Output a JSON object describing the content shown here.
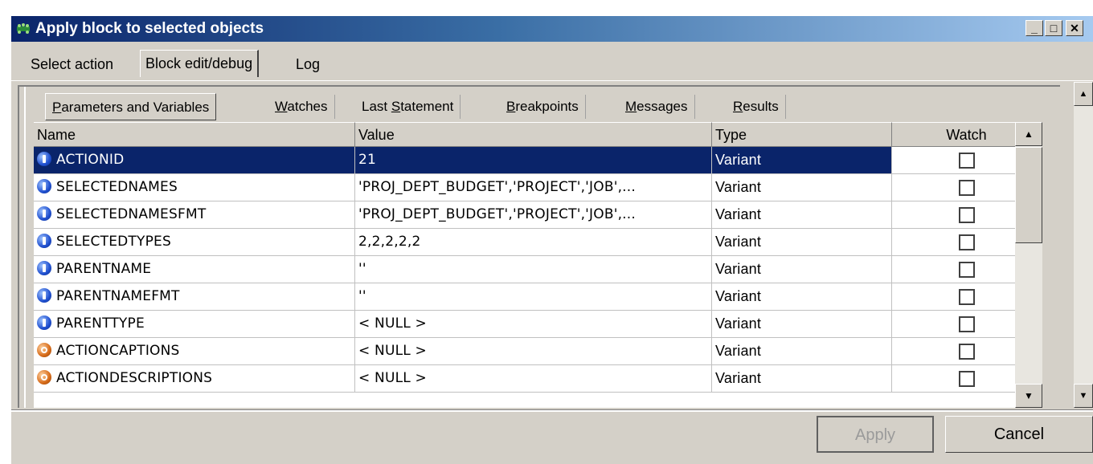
{
  "window": {
    "title": "Apply block to selected objects",
    "controls": {
      "minimize": "_",
      "maximize": "□",
      "close": "✕"
    }
  },
  "outer_tabs": [
    {
      "label": "Select action",
      "active": false
    },
    {
      "label": "Block edit/debug",
      "active": true
    },
    {
      "label": "Log",
      "active": false
    }
  ],
  "inner_tabs": [
    {
      "pre": "",
      "u": "P",
      "post": "arameters and Variables",
      "active": true
    },
    {
      "pre": "",
      "u": "W",
      "post": "atches",
      "active": false
    },
    {
      "pre": "Last ",
      "u": "S",
      "post": "tatement",
      "active": false
    },
    {
      "pre": "",
      "u": "B",
      "post": "reakpoints",
      "active": false
    },
    {
      "pre": "",
      "u": "M",
      "post": "essages",
      "active": false
    },
    {
      "pre": "",
      "u": "R",
      "post": "esults",
      "active": false
    }
  ],
  "grid": {
    "columns": {
      "name": "Name",
      "value": "Value",
      "type": "Type",
      "watch": "Watch"
    },
    "rows": [
      {
        "name": "ACTIONID",
        "value": "21",
        "type": "Variant",
        "kind": "in",
        "selected": true
      },
      {
        "name": "SELECTEDNAMES",
        "value": "'PROJ_DEPT_BUDGET','PROJECT','JOB',...",
        "type": "Variant",
        "kind": "in"
      },
      {
        "name": "SELECTEDNAMESFMT",
        "value": "'PROJ_DEPT_BUDGET','PROJECT','JOB',...",
        "type": "Variant",
        "kind": "in"
      },
      {
        "name": "SELECTEDTYPES",
        "value": "2,2,2,2,2",
        "type": "Variant",
        "kind": "in"
      },
      {
        "name": "PARENTNAME",
        "value": "''",
        "type": "Variant",
        "kind": "in"
      },
      {
        "name": "PARENTNAMEFMT",
        "value": "''",
        "type": "Variant",
        "kind": "in"
      },
      {
        "name": "PARENTTYPE",
        "value": "< NULL >",
        "type": "Variant",
        "kind": "in"
      },
      {
        "name": "ACTIONCAPTIONS",
        "value": "< NULL >",
        "type": "Variant",
        "kind": "out"
      },
      {
        "name": "ACTIONDESCRIPTIONS",
        "value": "< NULL >",
        "type": "Variant",
        "kind": "out"
      }
    ]
  },
  "buttons": {
    "apply": "Apply",
    "cancel": "Cancel"
  }
}
